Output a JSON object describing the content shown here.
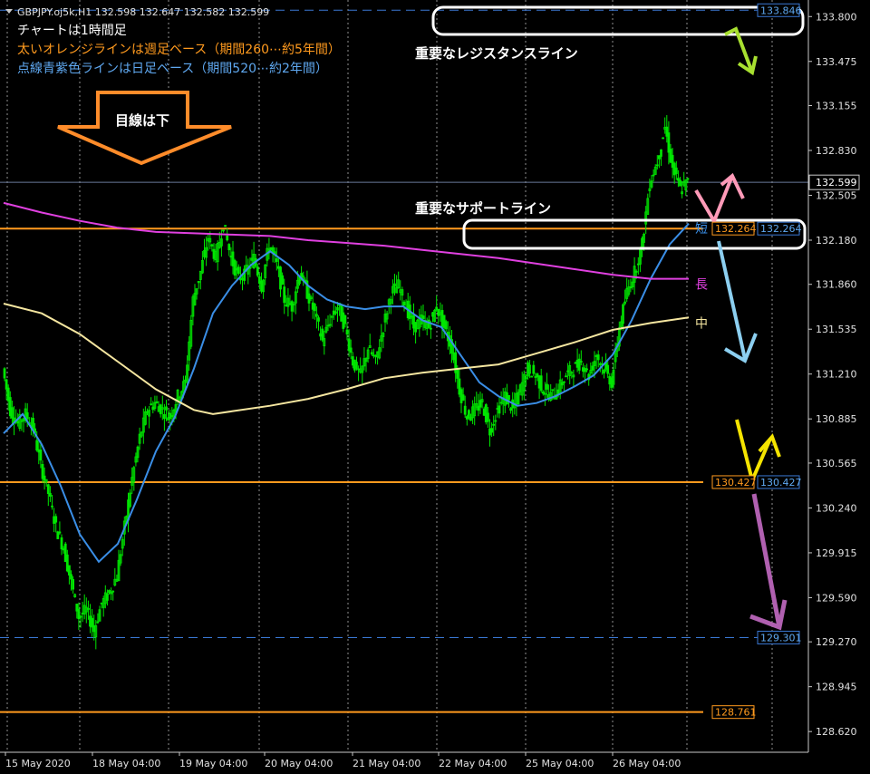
{
  "symbol_line": "GBPJPY.oj5k,H1  132.598 132.647 132.582 132.599",
  "chart_notes": [
    "チャートは1時間足",
    "太いオレンジラインは週足ベース（期間260⋯約5年間）",
    "点線青紫色ラインは日足ベース（期間520⋯約2年間）"
  ],
  "annotations": {
    "resistance": "重要なレジスタンスライン",
    "support": "重要なサポートライン",
    "view": "目線は下",
    "ma_short": "短",
    "ma_long": "長",
    "ma_mid": "中"
  },
  "colors": {
    "background": "#000000",
    "candles": "#00e600",
    "ma_short": "#3a8ee6",
    "ma_mid": "#f5e6a0",
    "ma_long": "#e040e0",
    "orange_line": "#ff9a1e",
    "blue_dashed": "#3a78d4",
    "current_price_line": "#6a7a99"
  },
  "chart_data": {
    "type": "line",
    "title": "GBPJPY.oj5k,H1",
    "ohlc_last": {
      "open": 132.598,
      "high": 132.647,
      "low": 132.582,
      "close": 132.599
    },
    "ylim": [
      128.47,
      133.92
    ],
    "y_ticks": [
      "133.800",
      "133.475",
      "133.155",
      "132.830",
      "132.505",
      "132.180",
      "131.860",
      "131.535",
      "131.210",
      "130.885",
      "130.565",
      "130.240",
      "129.915",
      "129.590",
      "129.270",
      "128.945",
      "128.620"
    ],
    "x_ticks": [
      "15 May 2020",
      "18 May 04:00",
      "19 May 04:00",
      "20 May 04:00",
      "21 May 04:00",
      "22 May 04:00",
      "25 May 04:00",
      "26 May 04:00"
    ],
    "current_price": 132.599,
    "horizontal_levels": [
      {
        "price": 133.846,
        "label": "133.846",
        "style": "dashed-blue"
      },
      {
        "price": 132.264,
        "label": "132.264",
        "style": "orange",
        "label2": "132.264"
      },
      {
        "price": 130.427,
        "label": "130.427",
        "style": "orange",
        "label2": "130.427"
      },
      {
        "price": 129.301,
        "label": "129.301",
        "style": "dashed-blue"
      },
      {
        "price": 128.761,
        "label": "128.761",
        "style": "orange"
      }
    ],
    "price_path": [
      [
        0,
        131.25
      ],
      [
        4,
        130.95
      ],
      [
        8,
        130.85
      ],
      [
        12,
        130.92
      ],
      [
        16,
        130.82
      ],
      [
        20,
        130.55
      ],
      [
        24,
        130.35
      ],
      [
        28,
        130.1
      ],
      [
        32,
        129.95
      ],
      [
        36,
        129.7
      ],
      [
        40,
        129.45
      ],
      [
        44,
        129.5
      ],
      [
        48,
        129.35
      ],
      [
        52,
        129.55
      ],
      [
        56,
        129.62
      ],
      [
        60,
        129.75
      ],
      [
        64,
        130.1
      ],
      [
        68,
        130.45
      ],
      [
        72,
        130.75
      ],
      [
        76,
        130.95
      ],
      [
        80,
        131.0
      ],
      [
        84,
        130.95
      ],
      [
        88,
        130.9
      ],
      [
        92,
        131.05
      ],
      [
        96,
        131.15
      ],
      [
        100,
        131.75
      ],
      [
        104,
        131.95
      ],
      [
        108,
        132.2
      ],
      [
        112,
        132.05
      ],
      [
        116,
        132.3
      ],
      [
        120,
        132.05
      ],
      [
        124,
        131.9
      ],
      [
        128,
        131.95
      ],
      [
        132,
        132.05
      ],
      [
        136,
        131.85
      ],
      [
        140,
        132.15
      ],
      [
        144,
        132.0
      ],
      [
        148,
        131.75
      ],
      [
        152,
        131.7
      ],
      [
        156,
        131.95
      ],
      [
        160,
        131.8
      ],
      [
        164,
        131.65
      ],
      [
        168,
        131.45
      ],
      [
        172,
        131.6
      ],
      [
        176,
        131.7
      ],
      [
        180,
        131.55
      ],
      [
        184,
        131.3
      ],
      [
        188,
        131.2
      ],
      [
        192,
        131.4
      ],
      [
        196,
        131.3
      ],
      [
        200,
        131.55
      ],
      [
        204,
        131.8
      ],
      [
        208,
        131.85
      ],
      [
        212,
        131.7
      ],
      [
        216,
        131.55
      ],
      [
        220,
        131.6
      ],
      [
        224,
        131.55
      ],
      [
        228,
        131.7
      ],
      [
        232,
        131.55
      ],
      [
        236,
        131.4
      ],
      [
        240,
        131.1
      ],
      [
        244,
        130.9
      ],
      [
        248,
        130.95
      ],
      [
        252,
        131.0
      ],
      [
        256,
        130.8
      ],
      [
        260,
        130.95
      ],
      [
        264,
        131.05
      ],
      [
        268,
        130.95
      ],
      [
        272,
        131.1
      ],
      [
        276,
        131.25
      ],
      [
        280,
        131.2
      ],
      [
        284,
        131.1
      ],
      [
        288,
        131.05
      ],
      [
        292,
        131.1
      ],
      [
        296,
        131.2
      ],
      [
        300,
        131.25
      ],
      [
        304,
        131.3
      ],
      [
        308,
        131.2
      ],
      [
        312,
        131.35
      ],
      [
        316,
        131.25
      ],
      [
        320,
        131.15
      ],
      [
        324,
        131.55
      ],
      [
        328,
        131.8
      ],
      [
        332,
        131.95
      ],
      [
        336,
        132.15
      ],
      [
        340,
        132.6
      ],
      [
        344,
        132.75
      ],
      [
        348,
        133.0
      ],
      [
        352,
        132.7
      ],
      [
        356,
        132.55
      ],
      [
        360,
        132.6
      ]
    ],
    "series": [
      {
        "name": "短",
        "values": [
          [
            0,
            130.78
          ],
          [
            10,
            130.92
          ],
          [
            20,
            130.7
          ],
          [
            30,
            130.4
          ],
          [
            40,
            130.05
          ],
          [
            50,
            129.85
          ],
          [
            60,
            129.98
          ],
          [
            70,
            130.3
          ],
          [
            80,
            130.65
          ],
          [
            90,
            130.9
          ],
          [
            100,
            131.25
          ],
          [
            110,
            131.65
          ],
          [
            120,
            131.85
          ],
          [
            130,
            132.0
          ],
          [
            140,
            132.1
          ],
          [
            150,
            132.0
          ],
          [
            160,
            131.85
          ],
          [
            170,
            131.75
          ],
          [
            180,
            131.7
          ],
          [
            190,
            131.68
          ],
          [
            200,
            131.7
          ],
          [
            210,
            131.7
          ],
          [
            220,
            131.6
          ],
          [
            230,
            131.55
          ],
          [
            240,
            131.35
          ],
          [
            250,
            131.15
          ],
          [
            260,
            131.05
          ],
          [
            270,
            130.98
          ],
          [
            280,
            131.0
          ],
          [
            290,
            131.05
          ],
          [
            300,
            131.12
          ],
          [
            310,
            131.2
          ],
          [
            320,
            131.35
          ],
          [
            330,
            131.6
          ],
          [
            340,
            131.9
          ],
          [
            350,
            132.15
          ],
          [
            360,
            132.3
          ]
        ]
      },
      {
        "name": "中",
        "values": [
          [
            0,
            131.72
          ],
          [
            20,
            131.65
          ],
          [
            40,
            131.5
          ],
          [
            60,
            131.3
          ],
          [
            80,
            131.1
          ],
          [
            100,
            130.95
          ],
          [
            110,
            130.92
          ],
          [
            120,
            130.94
          ],
          [
            140,
            130.98
          ],
          [
            160,
            131.03
          ],
          [
            180,
            131.1
          ],
          [
            200,
            131.18
          ],
          [
            220,
            131.22
          ],
          [
            240,
            131.25
          ],
          [
            260,
            131.28
          ],
          [
            280,
            131.36
          ],
          [
            300,
            131.44
          ],
          [
            320,
            131.53
          ],
          [
            340,
            131.58
          ],
          [
            360,
            131.62
          ]
        ]
      },
      {
        "name": "長",
        "values": [
          [
            0,
            132.45
          ],
          [
            20,
            132.38
          ],
          [
            40,
            132.32
          ],
          [
            60,
            132.27
          ],
          [
            80,
            132.24
          ],
          [
            100,
            132.23
          ],
          [
            120,
            132.22
          ],
          [
            140,
            132.21
          ],
          [
            160,
            132.18
          ],
          [
            180,
            132.16
          ],
          [
            200,
            132.14
          ],
          [
            220,
            132.11
          ],
          [
            240,
            132.08
          ],
          [
            260,
            132.05
          ],
          [
            280,
            132.01
          ],
          [
            300,
            131.97
          ],
          [
            320,
            131.93
          ],
          [
            340,
            131.9
          ],
          [
            360,
            131.9
          ]
        ]
      }
    ],
    "grid": true,
    "legend": "labels at right end of moving averages"
  }
}
